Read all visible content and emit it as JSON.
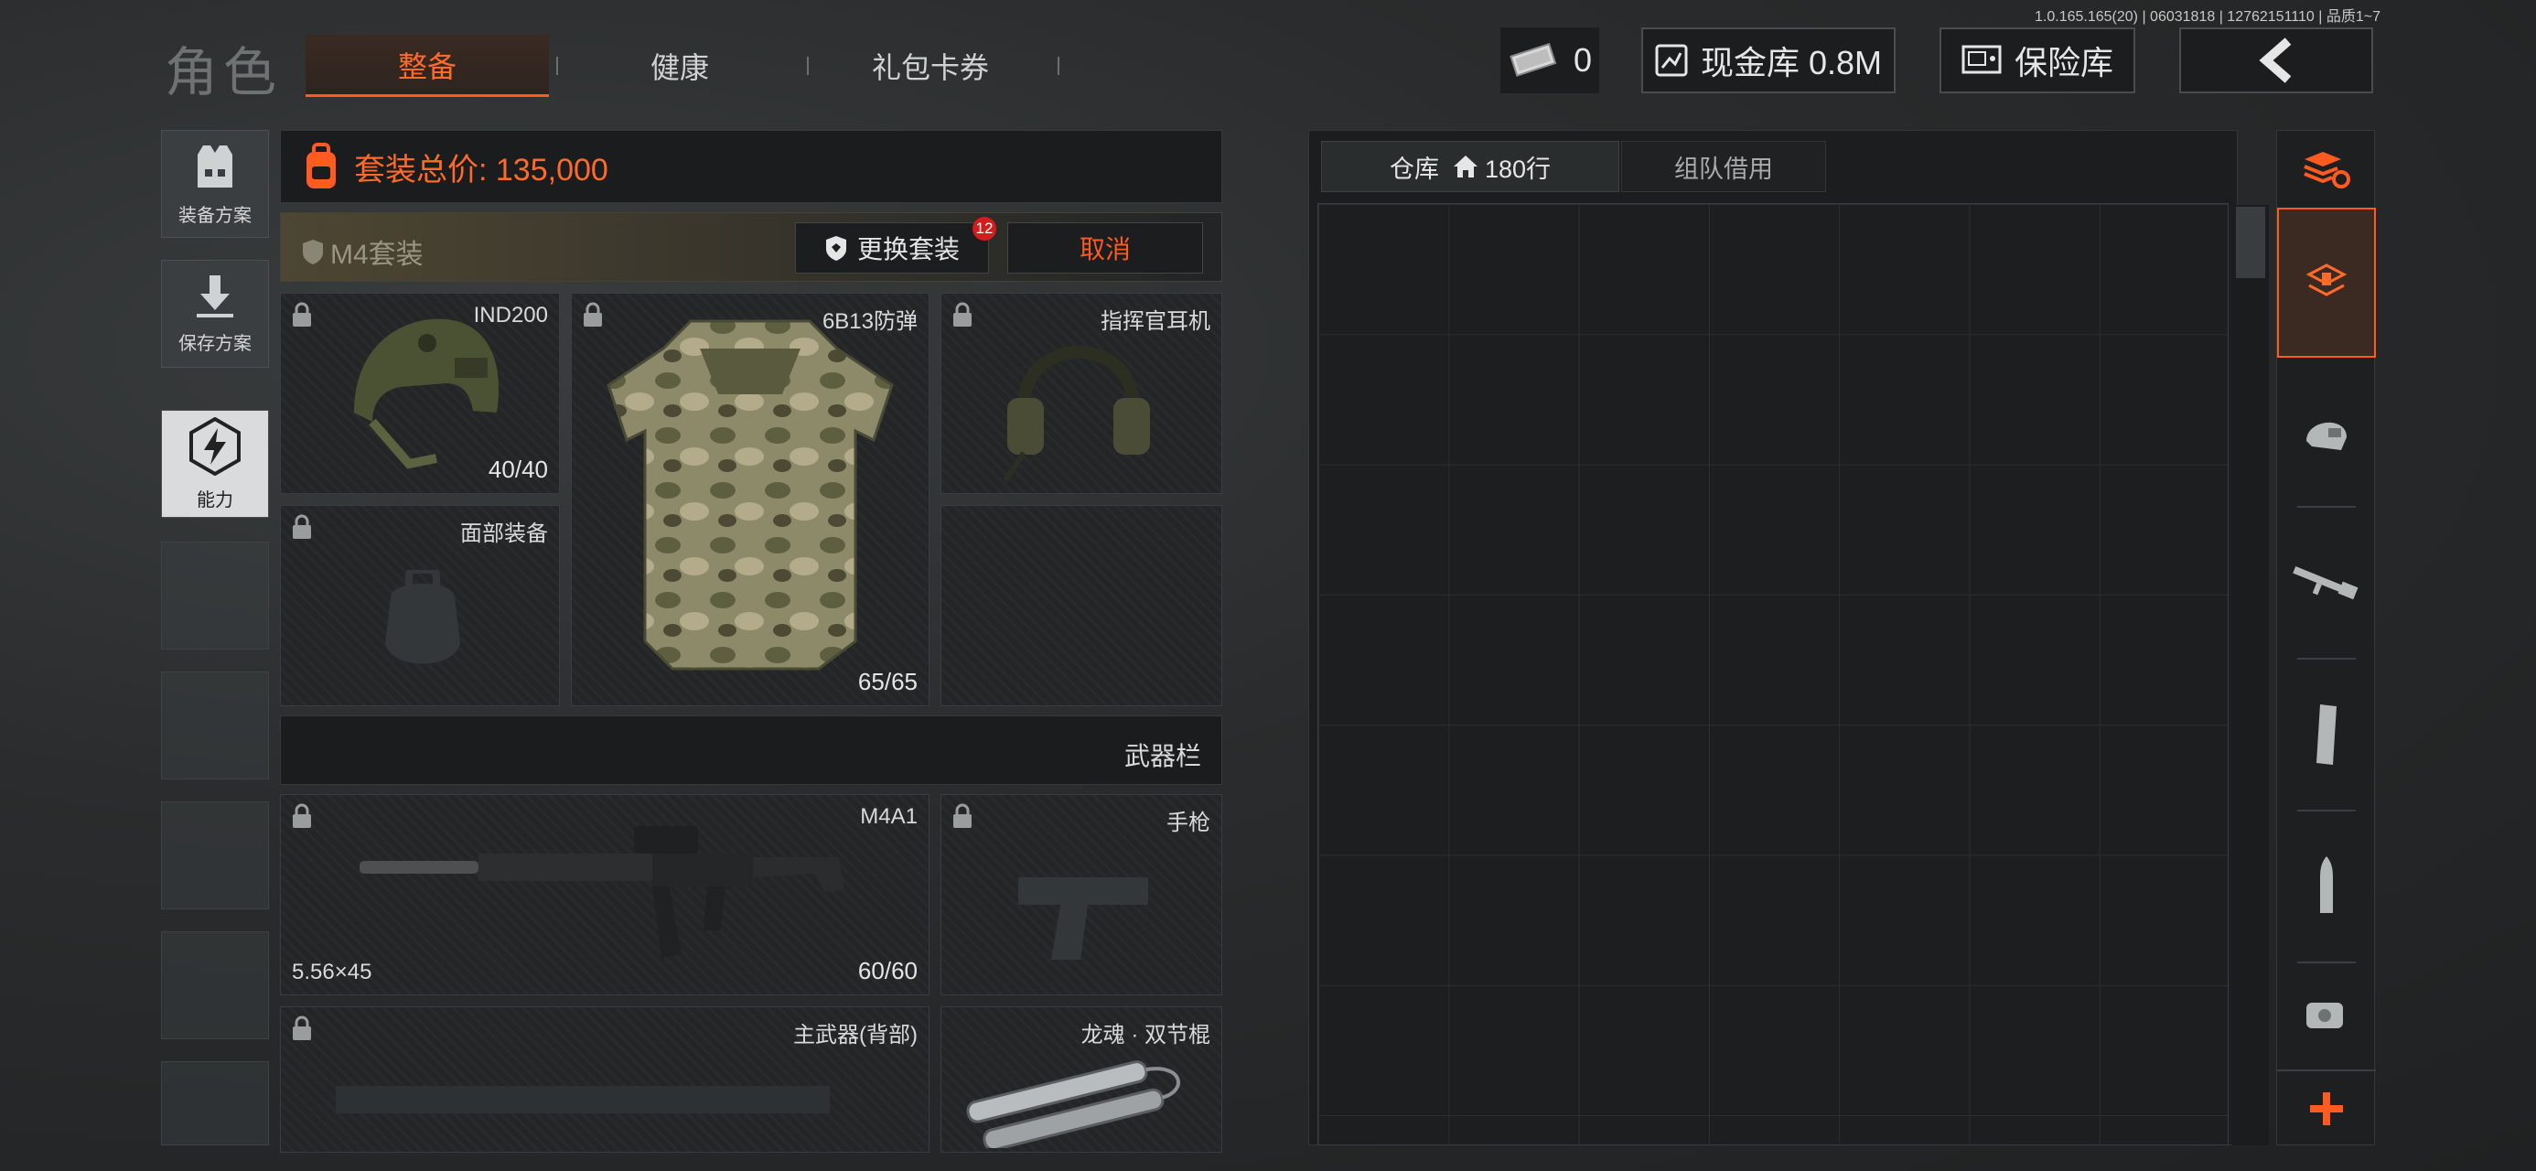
{
  "version_text": "1.0.165.165(20) | 06031818 | 12762151110 | 品质1~7",
  "header": {
    "title": "角色",
    "tabs": [
      {
        "label": "整备",
        "active": true
      },
      {
        "label": "健康",
        "active": false
      },
      {
        "label": "礼包卡券",
        "active": false
      }
    ],
    "currency_count": "0",
    "cash_vault": "现金库 0.8M",
    "safe_box": "保险库"
  },
  "sidebar": {
    "items": [
      {
        "label": "装备方案",
        "icon": "vest-plan-icon"
      },
      {
        "label": "保存方案",
        "icon": "download-icon"
      },
      {
        "label": "能力",
        "icon": "lightning-ability-icon"
      }
    ]
  },
  "loadout": {
    "total_price": "套装总价: 135,000",
    "kit_name": "M4套装",
    "change_kit_label": "更换套装",
    "change_kit_badge": "12",
    "cancel_label": "取消",
    "slots": {
      "helmet": {
        "name": "IND200",
        "durability": "40/40"
      },
      "armor": {
        "name": "6B13防弹",
        "durability": "65/65"
      },
      "headset": {
        "name": "指挥官耳机"
      },
      "face": {
        "name": "面部装备"
      },
      "weapons_header": "武器栏",
      "primary": {
        "name": "M4A1",
        "caliber": "5.56×45",
        "durability": "60/60"
      },
      "pistol": {
        "name": "手枪"
      },
      "primary_back": {
        "name": "主武器(背部)"
      },
      "melee": {
        "name": "龙魂 · 双节棍"
      }
    }
  },
  "storage": {
    "tabs": [
      {
        "label": "仓库",
        "rows": "180行",
        "active": true
      },
      {
        "label": "组队借用",
        "active": false
      }
    ]
  },
  "right_bar": {
    "items": [
      "stack-refresh-icon",
      "storage-layer-icon",
      "helmet-filter-icon",
      "rifle-filter-icon",
      "magazine-filter-icon",
      "ammo-filter-icon",
      "scope-filter-icon",
      "add-icon"
    ]
  },
  "colors": {
    "accent": "#ff5a1f",
    "badge": "#d21d1d"
  }
}
